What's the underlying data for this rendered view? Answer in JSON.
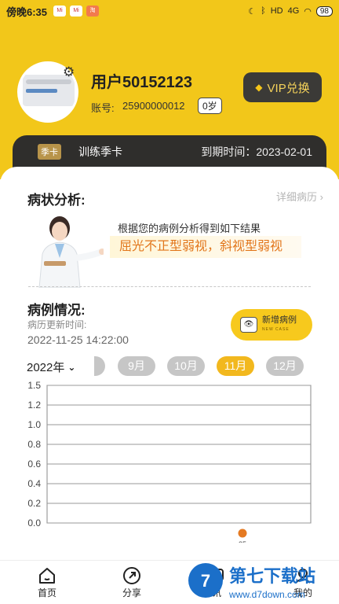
{
  "status_bar": {
    "time": "傍晚6:35",
    "icons": [
      "mi-icon",
      "mi-icon",
      "taobao-icon"
    ],
    "signal": "4G",
    "battery": "98"
  },
  "profile": {
    "username": "用户50152123",
    "account_label": "账号:",
    "account_no": "25900000012",
    "age": "0岁",
    "vip_label": "VIP兑换"
  },
  "card": {
    "tag": "季卡",
    "name": "训练季卡",
    "expiry": "到期时间：2023-02-01"
  },
  "analysis": {
    "title": "病状分析:",
    "detail_link": "详细病历",
    "intro": "根据您的病例分析得到如下结果",
    "result": "屈光不正型弱视，斜视型弱视"
  },
  "cases": {
    "title": "病例情况:",
    "update_label": "病历更新时间:",
    "update_time": "2022-11-25 14:22:00",
    "new_case_label": "新增病例",
    "new_case_sub": "NEW CASE"
  },
  "timeline": {
    "year": "2022年",
    "months": [
      "9月",
      "10月",
      "11月",
      "12月"
    ],
    "active_month": "11月"
  },
  "chart_data": {
    "type": "scatter",
    "y_ticks": [
      "1.5",
      "1.2",
      "1.0",
      "0.8",
      "0.6",
      "0.4",
      "0.2",
      "0.0"
    ],
    "x_ticks": [
      "25"
    ],
    "points": [
      {
        "x": "25",
        "y": 0.0
      }
    ],
    "point_color": "#e57a22",
    "grid": true
  },
  "nav": {
    "items": [
      {
        "label": "首页",
        "icon": "home-icon"
      },
      {
        "label": "分享",
        "icon": "share-icon"
      },
      {
        "label": "讯",
        "icon": "message-icon"
      },
      {
        "label": "我的",
        "icon": "profile-icon"
      }
    ]
  },
  "watermark": {
    "brand": "第七下载站",
    "url": "www.d7down.com"
  }
}
